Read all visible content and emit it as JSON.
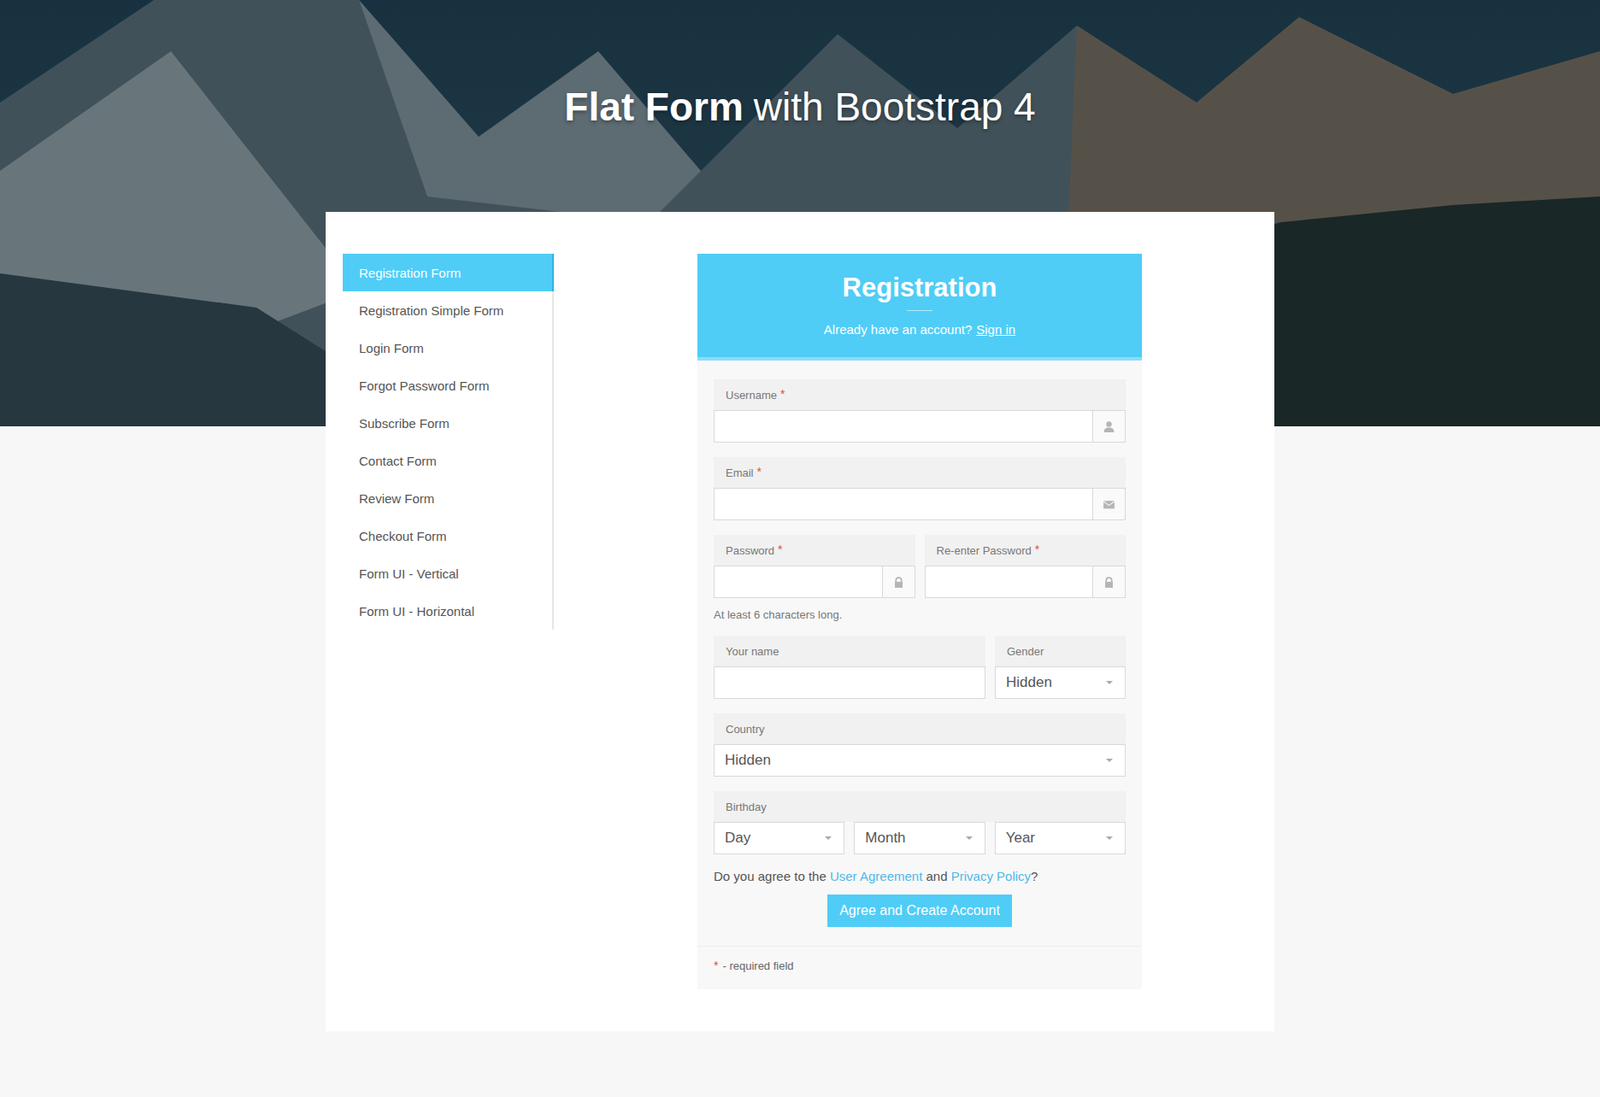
{
  "page": {
    "title_bold": "Flat Form",
    "title_rest": "with Bootstrap 4"
  },
  "sidebar": {
    "items": [
      {
        "label": "Registration Form",
        "selected": true
      },
      {
        "label": "Registration Simple Form",
        "selected": false
      },
      {
        "label": "Login Form",
        "selected": false
      },
      {
        "label": "Forgot Password Form",
        "selected": false
      },
      {
        "label": "Subscribe Form",
        "selected": false
      },
      {
        "label": "Contact Form",
        "selected": false
      },
      {
        "label": "Review Form",
        "selected": false
      },
      {
        "label": "Checkout Form",
        "selected": false
      },
      {
        "label": "Form UI - Vertical",
        "selected": false
      },
      {
        "label": "Form UI - Horizontal",
        "selected": false
      }
    ]
  },
  "form": {
    "title": "Registration",
    "signin_prompt": "Already have an account?",
    "signin_link": "Sign in",
    "required_mark": "*",
    "rows": [
      {
        "hint": "",
        "cells": [
          {
            "label": "Username",
            "required": true,
            "controls": [
              {
                "kind": "user-input",
                "value": ""
              }
            ]
          }
        ]
      },
      {
        "hint": "",
        "cells": [
          {
            "label": "Email",
            "required": true,
            "controls": [
              {
                "kind": "email-input",
                "value": ""
              }
            ]
          }
        ]
      },
      {
        "hint": "At least 6 characters long.",
        "cells": [
          {
            "label": "Password",
            "required": true,
            "controls": [
              {
                "kind": "password-input",
                "value": ""
              }
            ]
          },
          {
            "label": "Re-enter Password",
            "required": true,
            "controls": [
              {
                "kind": "password-input",
                "value": ""
              }
            ]
          }
        ]
      },
      {
        "hint": "",
        "cells": [
          {
            "label": "Your name",
            "required": false,
            "controls": [
              {
                "kind": "text-input",
                "value": ""
              }
            ]
          },
          {
            "label": "Gender",
            "required": false,
            "controls": [
              {
                "kind": "select",
                "value": "Hidden"
              }
            ]
          }
        ]
      },
      {
        "hint": "",
        "cells": [
          {
            "label": "Country",
            "required": false,
            "controls": [
              {
                "kind": "select",
                "value": "Hidden"
              }
            ]
          }
        ]
      },
      {
        "hint": "",
        "cells": [
          {
            "label": "Birthday",
            "required": false,
            "controls": [
              {
                "kind": "select",
                "value": "Day"
              },
              {
                "kind": "select",
                "value": "Month"
              },
              {
                "kind": "select",
                "value": "Year"
              }
            ]
          }
        ]
      }
    ],
    "agreement": [
      {
        "text": "Do you agree to the ",
        "link": false
      },
      {
        "text": "User Agreement",
        "link": true
      },
      {
        "text": " and ",
        "link": false
      },
      {
        "text": "Privacy Policy",
        "link": true
      },
      {
        "text": "?",
        "link": false
      }
    ],
    "submit": "Agree and Create Account",
    "footer_text": "- required field"
  }
}
